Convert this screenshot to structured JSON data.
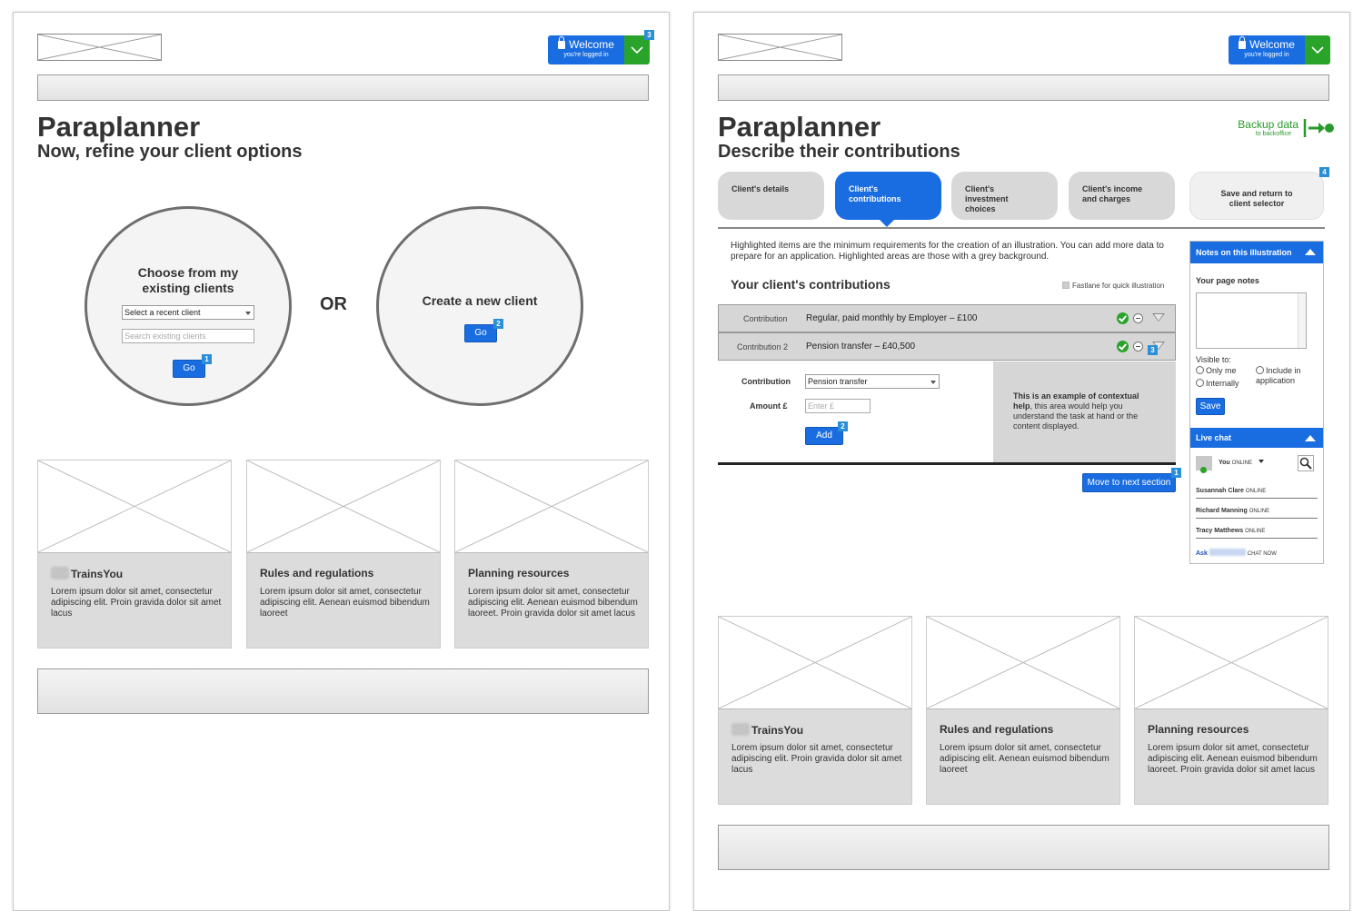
{
  "left_page": {
    "welcome": {
      "title": "Welcome",
      "subtitle": "you're logged in",
      "badge": "3"
    },
    "title": "Paraplanner",
    "subtitle": "Now, refine your client options",
    "existing": {
      "title": "Choose from my existing clients",
      "select_value": "Select a recent client",
      "search_placeholder": "Search existing clients",
      "go_label": "Go",
      "badge": "1"
    },
    "or_label": "OR",
    "create": {
      "title": "Create a new client",
      "go_label": "Go",
      "badge": "2"
    },
    "cards": [
      {
        "title": "TrainsYou",
        "text": "Lorem ipsum dolor sit amet, consectetur adipiscing elit. Proin gravida dolor sit amet lacus"
      },
      {
        "title": "Rules and regulations",
        "text": "Lorem ipsum dolor sit amet, consectetur adipiscing elit. Aenean euismod bibendum laoreet"
      },
      {
        "title": "Planning resources",
        "text": "Lorem ipsum dolor sit amet, consectetur adipiscing elit. Aenean euismod bibendum laoreet. Proin gravida dolor sit amet lacus"
      }
    ]
  },
  "right_page": {
    "welcome": {
      "title": "Welcome",
      "subtitle": "you're logged in"
    },
    "title": "Paraplanner",
    "subtitle": "Describe their contributions",
    "backup": {
      "title": "Backup data",
      "subtitle": "to backoffice"
    },
    "tabs": [
      {
        "label": "Client's details"
      },
      {
        "label": "Client's contributions"
      },
      {
        "label": "Client's investment choices"
      },
      {
        "label": "Client's income and charges"
      }
    ],
    "save_return": {
      "label": "Save and return to client selector",
      "badge": "4"
    },
    "intro": "Highlighted items are the minimum requirements for the creation of an illustration. You can add more data to prepare for an application. Highlighted areas are those with a grey background.",
    "section_title": "Your client's contributions",
    "fastlane": "Fastlane for quick illustration",
    "contributions": [
      {
        "label": "Contribution",
        "value": "Regular, paid monthly by Employer – £100"
      },
      {
        "label": "Contribution 2",
        "value": "Pension transfer – £40,500",
        "badge": "3"
      }
    ],
    "form": {
      "contribution_label": "Contribution",
      "contribution_value": "Pension transfer",
      "amount_label": "Amount £",
      "amount_placeholder": "Enter £",
      "add_label": "Add",
      "add_badge": "2"
    },
    "context_help": {
      "bold": "This is an example of contextual help",
      "text": ", this area would help you understand the task at hand or the content displayed."
    },
    "next_section": {
      "label": "Move to next section",
      "badge": "1"
    },
    "notes": {
      "header": "Notes on this illustration",
      "page_notes_label": "Your page notes",
      "visible_to": "Visible to:",
      "only_me": "Only me",
      "internally": "Internally",
      "include": "Include in application",
      "save_label": "Save"
    },
    "chat": {
      "header": "Live chat",
      "you": "You",
      "online": "ONLINE",
      "people": [
        {
          "name": "Susannah Clare",
          "status": "ONLINE"
        },
        {
          "name": "Richard Manning",
          "status": "ONLINE"
        },
        {
          "name": "Tracy Matthews",
          "status": "ONLINE"
        }
      ],
      "ask": "Ask",
      "chat_now": "CHAT NOW"
    },
    "cards": [
      {
        "title": "TrainsYou",
        "text": "Lorem ipsum dolor sit amet, consectetur adipiscing elit. Proin gravida dolor sit amet lacus"
      },
      {
        "title": "Rules and regulations",
        "text": "Lorem ipsum dolor sit amet, consectetur adipiscing elit. Aenean euismod bibendum laoreet"
      },
      {
        "title": "Planning resources",
        "text": "Lorem ipsum dolor sit amet, consectetur adipiscing elit. Aenean euismod bibendum laoreet. Proin gravida dolor sit amet lacus"
      }
    ]
  },
  "colors": {
    "primary": "#1a6de0",
    "success": "#2aa32a",
    "badge": "#2a8fd8",
    "panel": "#d6d6d6"
  }
}
